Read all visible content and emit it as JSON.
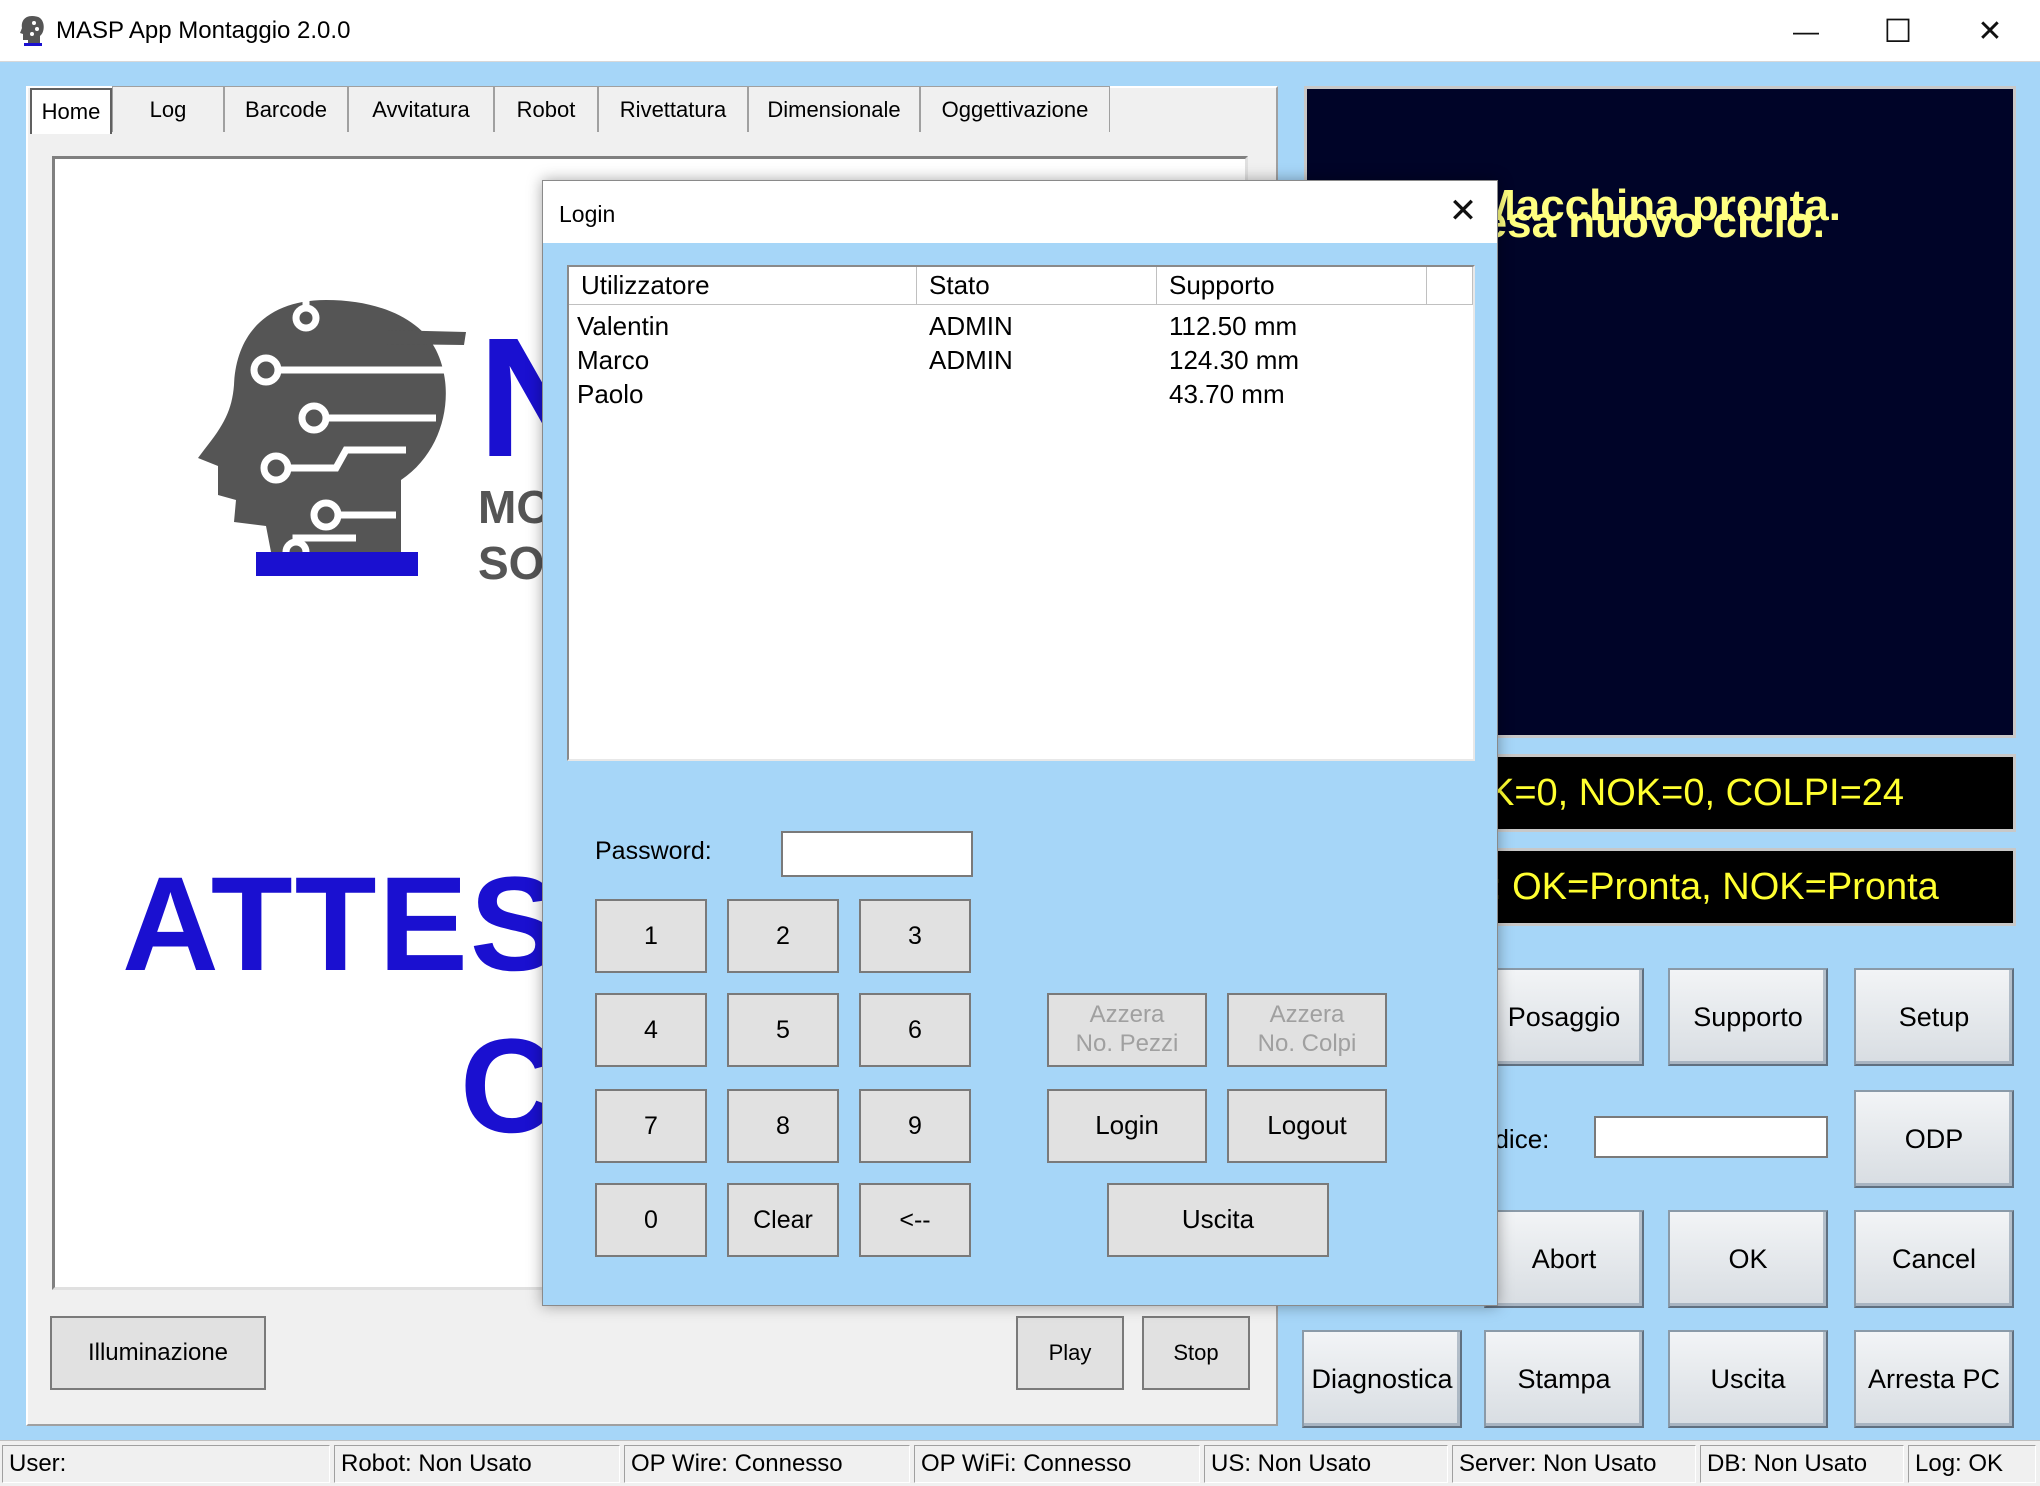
{
  "window": {
    "title": "MASP App Montaggio 2.0.0",
    "minimize_glyph": "—",
    "maximize_glyph": "☐",
    "close_glyph": "✕"
  },
  "tabs": [
    {
      "label": "Home"
    },
    {
      "label": "Log"
    },
    {
      "label": "Barcode"
    },
    {
      "label": "Avvitatura"
    },
    {
      "label": "Robot"
    },
    {
      "label": "Rivettatura"
    },
    {
      "label": "Dimensionale"
    },
    {
      "label": "Oggettivazione"
    }
  ],
  "home": {
    "logo_letters": "N",
    "logo_sub1": "MO",
    "logo_sub2": "SO",
    "attesa_line1": "ATTES",
    "attesa_line2": "C",
    "illuminazione_label": "Illuminazione",
    "play_label": "Play",
    "stop_label": "Stop"
  },
  "status_panel": {
    "message_line1": "Macchina pronta.",
    "message_line2": "tesa nuovo ciclo.",
    "counter_text": "K=0, NOK=0, COLPI=24",
    "state_text": ": OK=Pronta, NOK=Pronta"
  },
  "controls": {
    "posaggio": "Posaggio",
    "supporto": "Supporto",
    "setup": "Setup",
    "codice_label": "odice:",
    "odp": "ODP",
    "abort": "Abort",
    "ok": "OK",
    "cancel": "Cancel",
    "diagnostica": "Diagnostica",
    "stampa": "Stampa",
    "uscita": "Uscita",
    "arresta_pc": "Arresta PC"
  },
  "statusbar": [
    {
      "text": "User:"
    },
    {
      "text": "Robot: Non Usato"
    },
    {
      "text": "OP Wire: Connesso"
    },
    {
      "text": "OP WiFi: Connesso"
    },
    {
      "text": "US: Non Usato"
    },
    {
      "text": "Server: Non Usato"
    },
    {
      "text": "DB: Non Usato"
    },
    {
      "text": "Log: OK"
    }
  ],
  "login": {
    "title": "Login",
    "close_glyph": "✕",
    "columns": [
      "Utilizzatore",
      "Stato",
      "Supporto"
    ],
    "users": [
      {
        "name": "Valentin",
        "stato": "ADMIN",
        "supporto": "112.50 mm"
      },
      {
        "name": "Marco",
        "stato": "ADMIN",
        "supporto": "124.30 mm"
      },
      {
        "name": "Paolo",
        "stato": "",
        "supporto": "43.70 mm"
      }
    ],
    "password_label": "Password:",
    "password_value": "",
    "keys": [
      "1",
      "2",
      "3",
      "4",
      "5",
      "6",
      "7",
      "8",
      "9",
      "0",
      "Clear",
      "<--"
    ],
    "azzera_pezzi_1": "Azzera",
    "azzera_pezzi_2": "No. Pezzi",
    "azzera_colpi_1": "Azzera",
    "azzera_colpi_2": "No. Colpi",
    "login_btn": "Login",
    "logout_btn": "Logout",
    "uscita_btn": "Uscita"
  }
}
